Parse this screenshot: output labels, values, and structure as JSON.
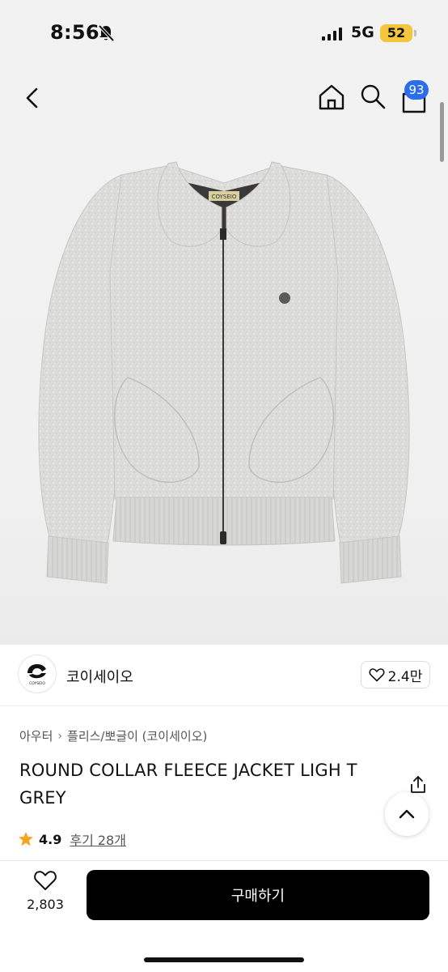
{
  "status_bar": {
    "time": "8:56",
    "network": "5G",
    "battery": "52",
    "battery_color": "#f3c63b",
    "icons": [
      "bell-slash-icon",
      "signal-icon"
    ]
  },
  "nav": {
    "icons": [
      "back-icon",
      "home-icon",
      "search-icon",
      "cart-icon"
    ],
    "cart_badge": "93",
    "badge_color": "#2b6dea"
  },
  "product_image": {
    "logo_text": "COYSEIO"
  },
  "seller": {
    "name": "코이세이오",
    "logo_text": "COYSEIO",
    "likes": "2.4만"
  },
  "breadcrumb": {
    "category": "아우터",
    "subcategory": "플리스/뽀글이 (코이세이오)"
  },
  "product": {
    "title": "ROUND COLLAR FLEECE JACKET LIGH T GREY",
    "rating": "4.9",
    "reviews": "후기 28개",
    "star_color": "#f5a623"
  },
  "bottom_bar": {
    "wish_count": "2,803",
    "buy_label": "구매하기"
  }
}
